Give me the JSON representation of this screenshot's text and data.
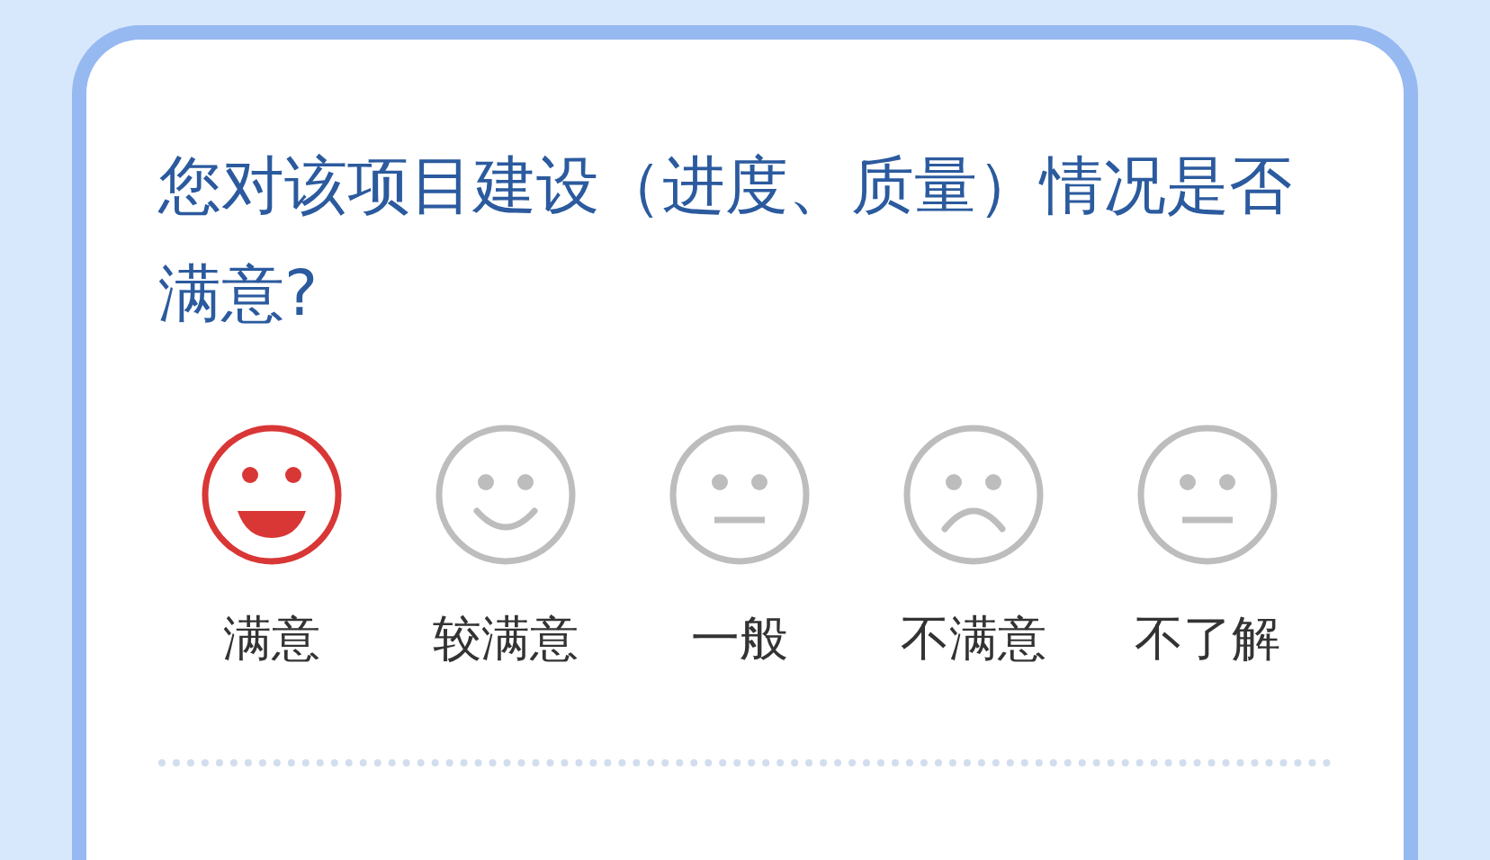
{
  "question": "您对该项目建设（进度、质量）情况是否满意?",
  "options": [
    {
      "label": "满意",
      "kind": "laugh",
      "selected": true
    },
    {
      "label": "较满意",
      "kind": "smile",
      "selected": false
    },
    {
      "label": "一般",
      "kind": "neutral",
      "selected": false
    },
    {
      "label": "不满意",
      "kind": "sad",
      "selected": false
    },
    {
      "label": "不了解",
      "kind": "neutral",
      "selected": false
    }
  ]
}
